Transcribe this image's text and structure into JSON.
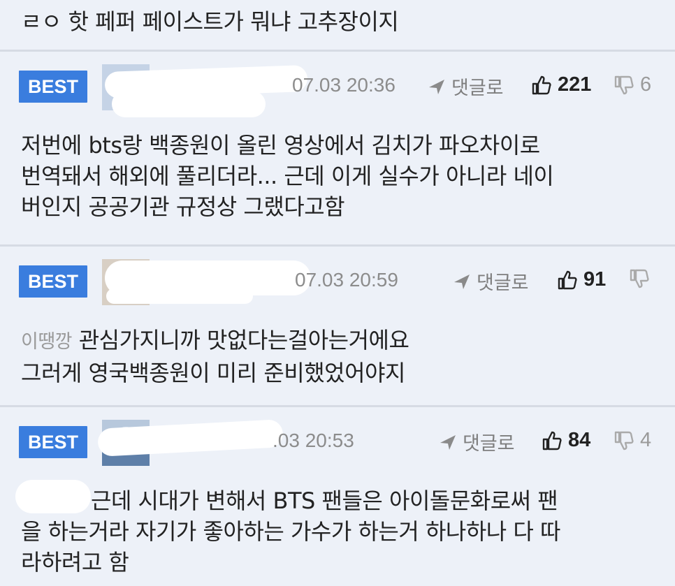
{
  "top_comment": {
    "text": "ㄹㅇ 핫 페퍼 페이스트가 뭐냐 고추장이지"
  },
  "comments": [
    {
      "badge": "BEST",
      "time": "07.03 20:36",
      "reply_label": "댓글로",
      "likes": "221",
      "dislikes": "6",
      "lines": [
        "저번에 bts랑 백종원이 올린 영상에서 김치가 파오차이로",
        "번역돼서 해외에 풀리더라... 근데 이게 실수가 아니라 네이",
        "버인지 공공기관 규정상 그랬다고함"
      ]
    },
    {
      "badge": "BEST",
      "time": "07.03 20:59",
      "reply_label": "댓글로",
      "likes": "91",
      "dislikes": "",
      "mention": "이땡깡",
      "lines": [
        "관심가지니까 맛없다는걸아는거에요",
        "그러게 영국백종원이 미리 준비했었어야지"
      ]
    },
    {
      "badge": "BEST",
      "time": ".03 20:53",
      "reply_label": "댓글로",
      "likes": "84",
      "dislikes": "4",
      "lines": [
        "근데 시대가 변해서 BTS 팬들은 아이돌문화로써 팬",
        "을 하는거라 자기가 좋아하는 가수가 하는거 하나하나 다 따",
        "라하려고 함"
      ]
    }
  ]
}
